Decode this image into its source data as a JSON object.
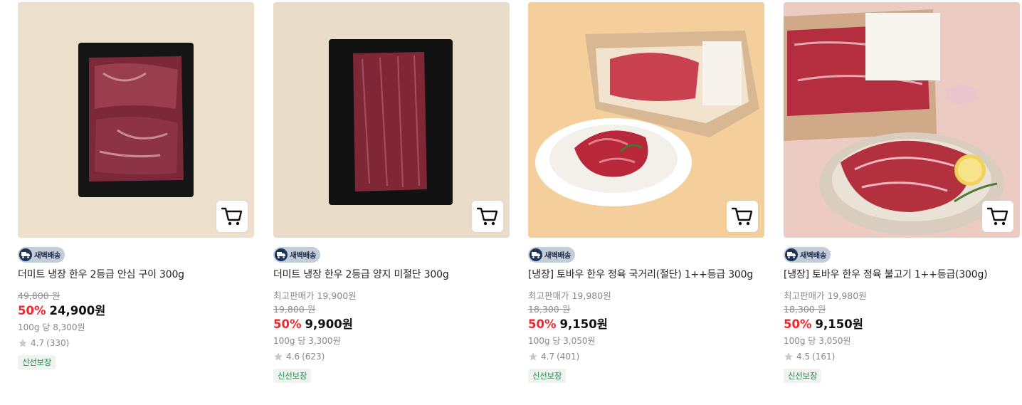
{
  "products": [
    {
      "badge": "새벽배송",
      "title": "더미트 냉장 한우 2등급 안심 구이 300g",
      "original_price": "49,800 원",
      "discount": "50%",
      "price": "24,900원",
      "unit_price": "100g 당 8,300원",
      "rating": "4.7",
      "reviews": "(330)",
      "tag": "신선보장"
    },
    {
      "badge": "새벽배송",
      "title": "더미트 냉장 한우 2등급 양지 미절단 300g",
      "best_price": "최고판매가 19,900원",
      "original_price": "19,800 원",
      "discount": "50%",
      "price": "9,900원",
      "unit_price": "100g 당 3,300원",
      "rating": "4.6",
      "reviews": "(623)",
      "tag": "신선보장"
    },
    {
      "badge": "새벽배송",
      "title": "[냉장] 토바우 한우 정육 국거리(절단) 1++등급 300g",
      "best_price": "최고판매가 19,980원",
      "original_price": "18,300 원",
      "discount": "50%",
      "price": "9,150원",
      "unit_price": "100g 당 3,050원",
      "rating": "4.7",
      "reviews": "(401)",
      "tag": "신선보장"
    },
    {
      "badge": "새벽배송",
      "title": "[냉장] 토바우 한우 정육 불고기 1++등급(300g)",
      "best_price": "최고판매가 19,980원",
      "original_price": "18,300 원",
      "discount": "50%",
      "price": "9,150원",
      "unit_price": "100g 당 3,050원",
      "rating": "4.5",
      "reviews": "(161)",
      "tag": "신선보장"
    }
  ],
  "icons": {
    "cart": "cart-icon",
    "badge": "truck-icon",
    "rating": "star-icon"
  },
  "colors": {
    "discount": "#f0282d",
    "tag_text": "#1a8a4a",
    "badge_bg": "#c3ccd9",
    "badge_icon_bg": "#1e3457",
    "star": "#c8c8c8"
  }
}
